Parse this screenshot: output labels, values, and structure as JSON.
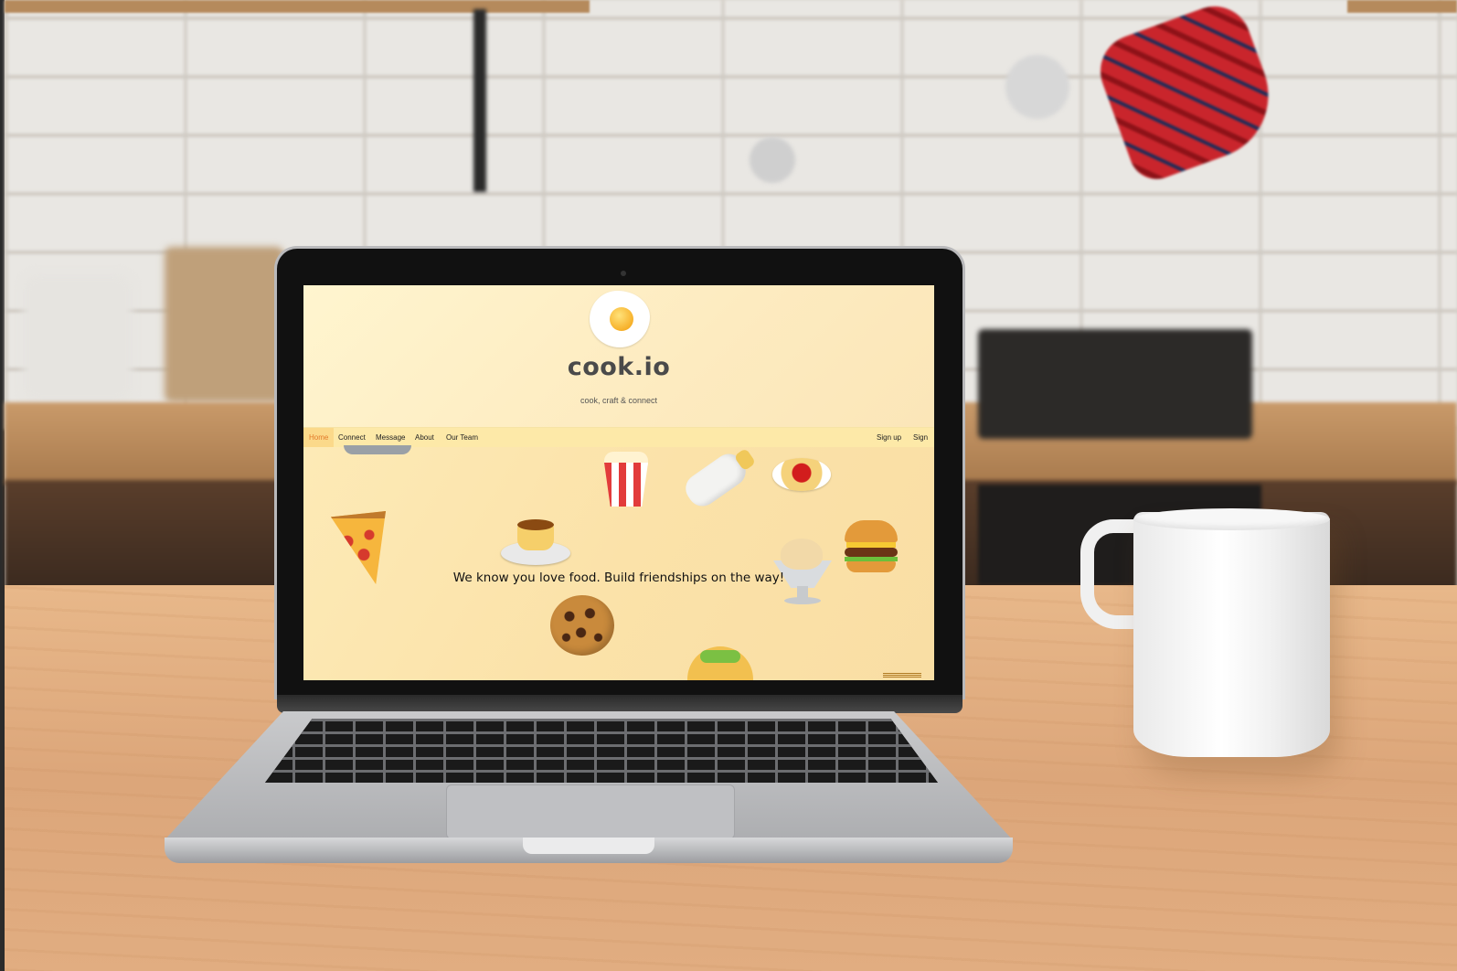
{
  "site": {
    "brand": "cook.io",
    "tagline": "cook, craft & connect",
    "logo_icon": "fried-egg-icon"
  },
  "nav": {
    "items": [
      {
        "label": "Home",
        "active": true
      },
      {
        "label": "Connect"
      },
      {
        "label": "Message"
      },
      {
        "label": "About"
      },
      {
        "label": "Our Team"
      }
    ],
    "sign_up": "Sign up",
    "sign_in": "Sign in"
  },
  "hero": {
    "text": "We know you love food. Build friendships on the way!",
    "decorations": [
      "popcorn-icon",
      "baby-bottle-icon",
      "spaghetti-icon",
      "pizza-icon",
      "flan-icon",
      "ice-cream-icon",
      "hamburger-icon",
      "cookie-icon",
      "taco-icon"
    ]
  },
  "colors": {
    "header_bg": "#fff5cf",
    "nav_bg": "#fde9a8",
    "active_nav": "#e27a2a",
    "hero_bg": "#fbe2a9"
  }
}
